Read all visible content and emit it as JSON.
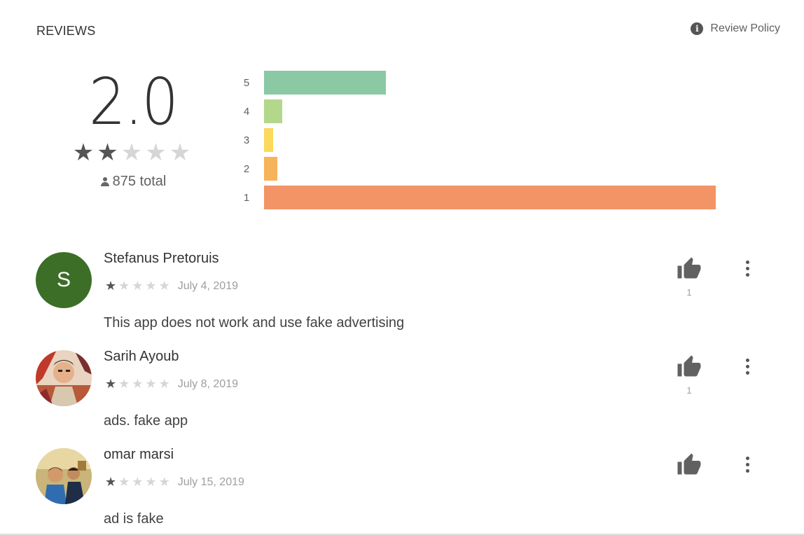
{
  "header": {
    "title": "REVIEWS",
    "policy_label": "Review Policy",
    "policy_icon": "info-icon"
  },
  "summary": {
    "score": "2.0",
    "stars_filled": 2,
    "stars_total": 5,
    "total_text": "875 total",
    "total_icon": "person-icon"
  },
  "histogram": [
    {
      "label": "5",
      "fraction": 0.27,
      "color": "#8bc9a4"
    },
    {
      "label": "4",
      "fraction": 0.04,
      "color": "#b3d88c"
    },
    {
      "label": "3",
      "fraction": 0.02,
      "color": "#fad95c"
    },
    {
      "label": "2",
      "fraction": 0.03,
      "color": "#f7b35a"
    },
    {
      "label": "1",
      "fraction": 1.0,
      "color": "#f39466"
    }
  ],
  "reviews": [
    {
      "name": "Stefanus Pretoruis",
      "rating": 1,
      "date": "July 4, 2019",
      "text": "This app does not work and use fake advertising",
      "likes": "1",
      "avatar_letter": "S",
      "avatar_type": "letter"
    },
    {
      "name": "Sarih Ayoub",
      "rating": 1,
      "date": "July 8, 2019",
      "text": "ads. fake app",
      "likes": "1",
      "avatar_type": "photo"
    },
    {
      "name": "omar marsi",
      "rating": 1,
      "date": "July 15, 2019",
      "text": "ad is fake",
      "likes": "",
      "avatar_type": "photo"
    }
  ],
  "icons": {
    "like": "thumbs-up-icon",
    "more": "more-vert-icon"
  }
}
